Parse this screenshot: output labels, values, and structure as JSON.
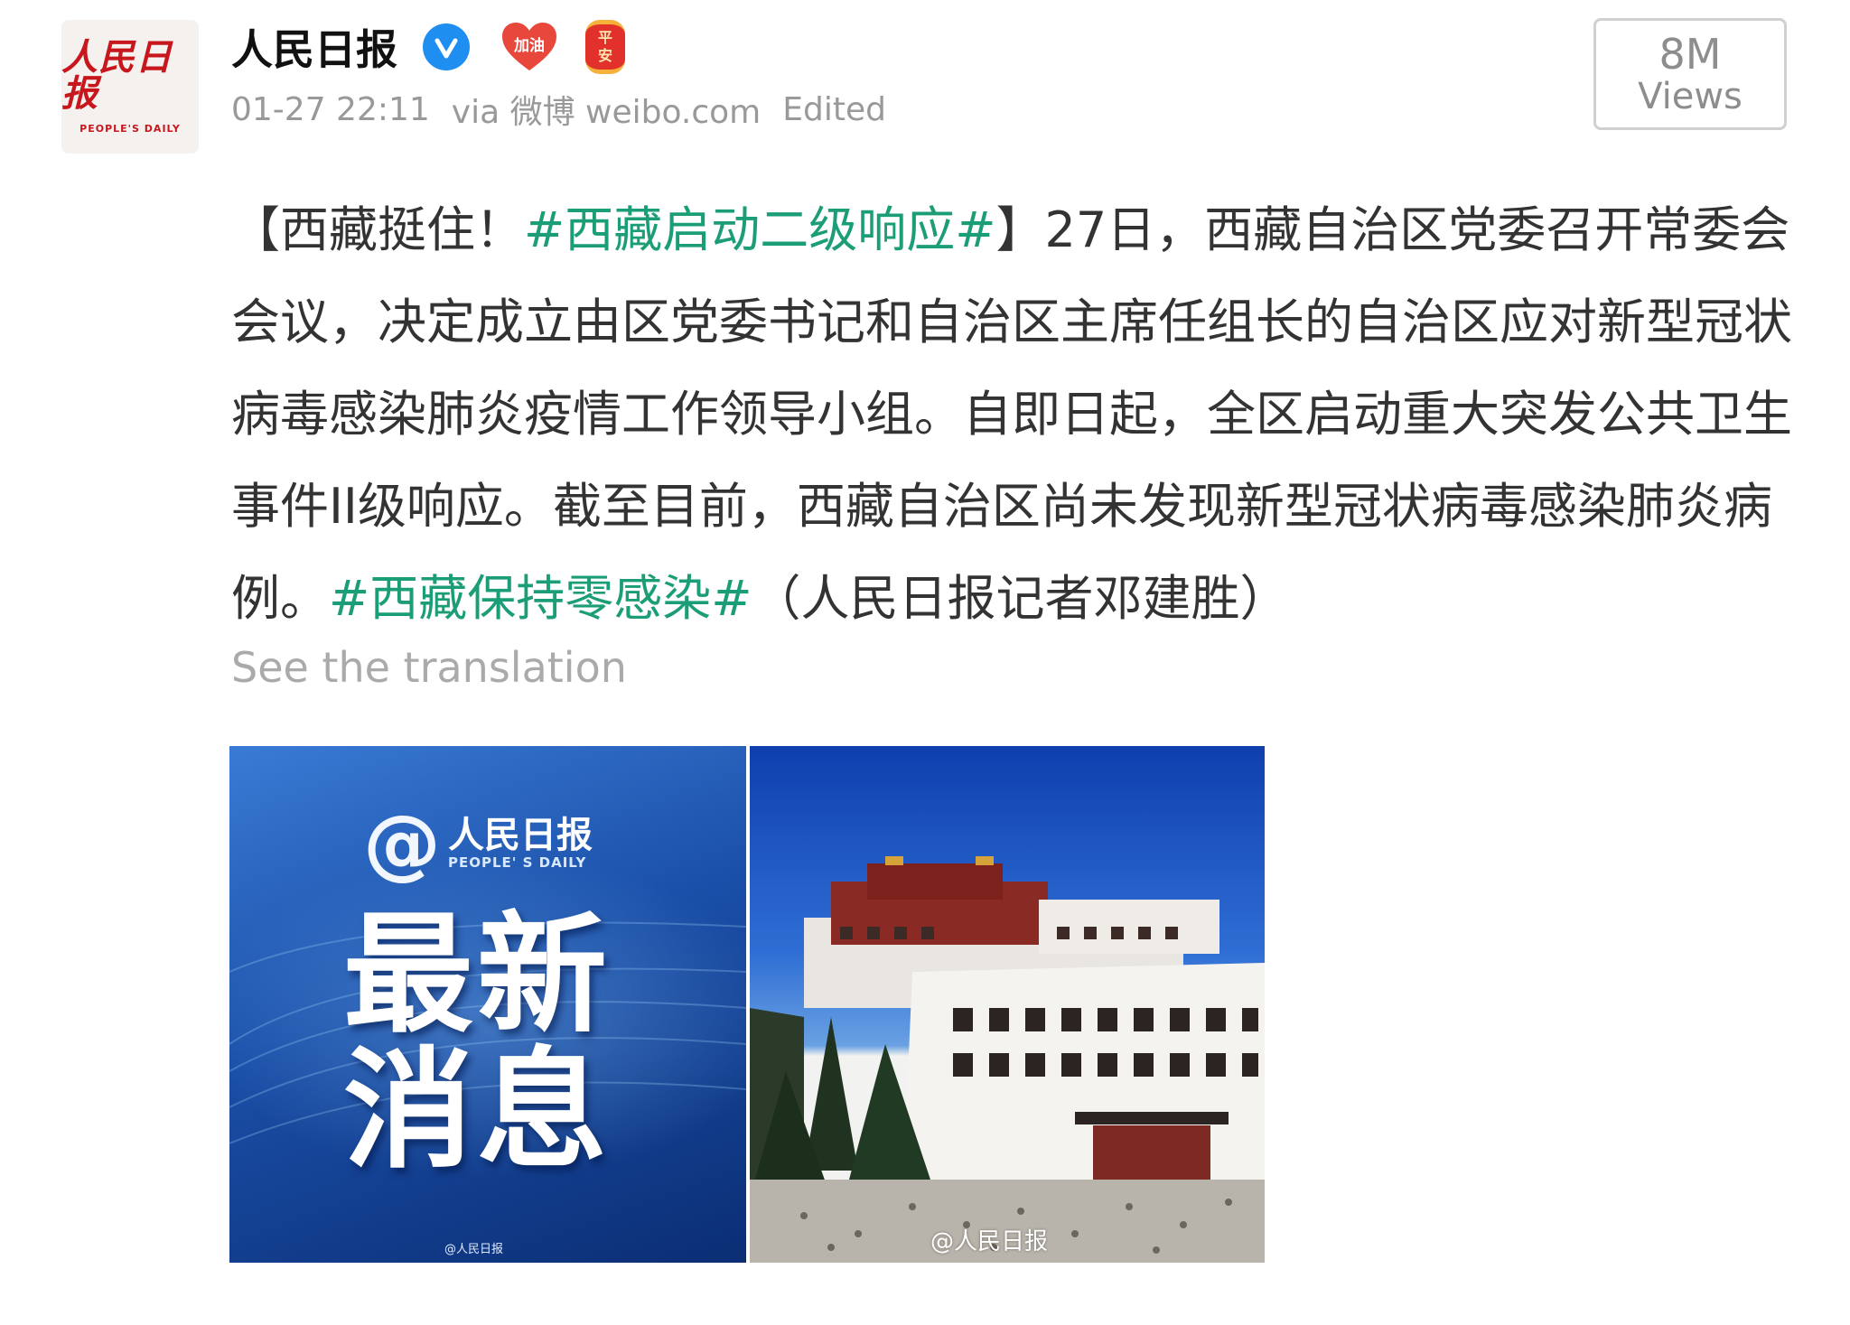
{
  "author": {
    "name": "人民日报",
    "avatar_logo_cn": "人民日报",
    "avatar_logo_en": "PEOPLE'S DAILY",
    "badge_jiayou": "加油",
    "badge_pingan": [
      "平",
      "安"
    ]
  },
  "meta": {
    "timestamp": "01-27 22:11",
    "via": "via 微博 weibo.com",
    "edited": "Edited"
  },
  "views": {
    "count": "8M",
    "label": "Views"
  },
  "post": {
    "seg1": "【西藏挺住！",
    "hashtag1": "#西藏启动二级响应#",
    "seg2": "】27日，西藏自治区党委召开常委会会议，决定成立由区党委书记和自治区主席任组长的自治区应对新型冠状病毒感染肺炎疫情工作领导小组。自即日起，全区启动重大突发公共卫生事件II级响应。截至目前，西藏自治区尚未发现新型冠状病毒感染肺炎病例。",
    "hashtag2": "#西藏保持零感染#",
    "seg3": "（人民日报记者邓建胜）"
  },
  "translate_label": "See the translation",
  "images": [
    {
      "brand_cn": "人民日报",
      "brand_en": "PEOPLE' S DAILY",
      "headline_line1": "最新",
      "headline_line2": "消息",
      "watermark": "@人民日报"
    },
    {
      "watermark": "@人民日报"
    }
  ],
  "colors": {
    "hashtag": "#1b9e77",
    "verified": "#1f8ef1",
    "brand_red": "#c8161d"
  }
}
